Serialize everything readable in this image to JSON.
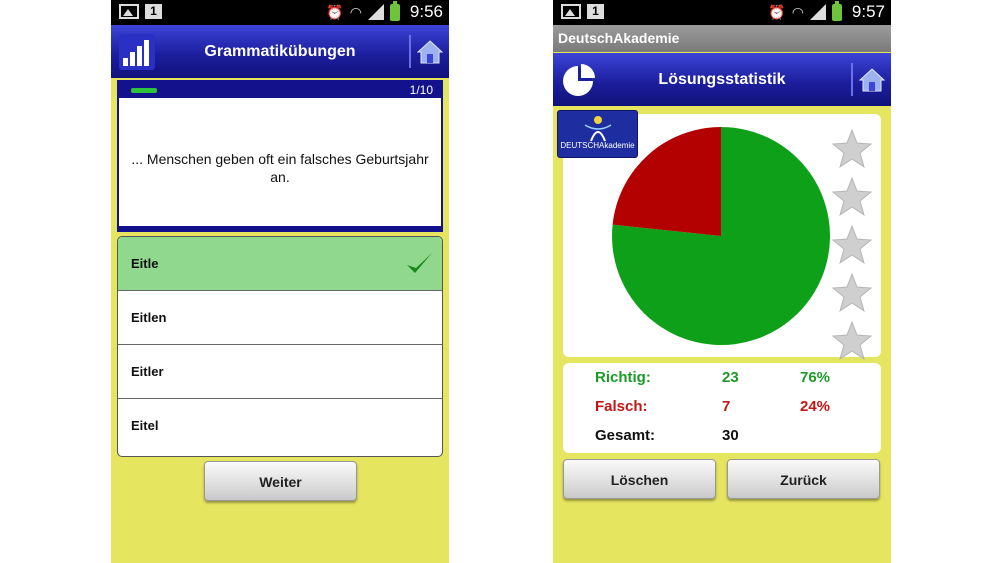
{
  "left_screen": {
    "status": {
      "sim_slot": "1",
      "time": "9:56"
    },
    "title": "Grammatikübungen",
    "question": {
      "counter": "1/10",
      "progress": 0.1,
      "text": "... Menschen geben oft ein falsches Geburtsjahr an."
    },
    "answers": [
      {
        "label": "Eitle",
        "correct": true
      },
      {
        "label": "Eitlen",
        "correct": false
      },
      {
        "label": "Eitler",
        "correct": false
      },
      {
        "label": "Eitel",
        "correct": false
      }
    ],
    "next_label": "Weiter"
  },
  "right_screen": {
    "status": {
      "sim_slot": "1",
      "time": "9:57"
    },
    "app_name": "DeutschAkademie",
    "title": "Lösungsstatistik",
    "logo_text": "DEUTSCHAkademie",
    "stats": {
      "correct": {
        "label": "Richtig:",
        "count": "23",
        "percent": "76%"
      },
      "wrong": {
        "label": "Falsch:",
        "count": "7",
        "percent": "24%"
      },
      "total": {
        "label": "Gesamt:",
        "count": "30"
      }
    },
    "delete_label": "Löschen",
    "back_label": "Zurück",
    "stars_total": 5,
    "stars_filled": 0
  },
  "chart_data": {
    "type": "pie",
    "categories": [
      "Richtig",
      "Falsch"
    ],
    "values": [
      23,
      7
    ],
    "colors": [
      "#0fa01a",
      "#b30000"
    ]
  },
  "colors": {
    "title_bar": "#1c1f9e",
    "background": "#e6e55f",
    "correct_highlight": "#8fd88d",
    "correct_text": "#1c9a27",
    "wrong_text": "#c01616"
  },
  "icons": [
    "image-icon",
    "alarm-icon",
    "wifi-icon",
    "signal-icon",
    "battery-icon",
    "bar-chart-icon",
    "home-icon",
    "pie-chart-icon",
    "check-icon",
    "star-icon"
  ]
}
